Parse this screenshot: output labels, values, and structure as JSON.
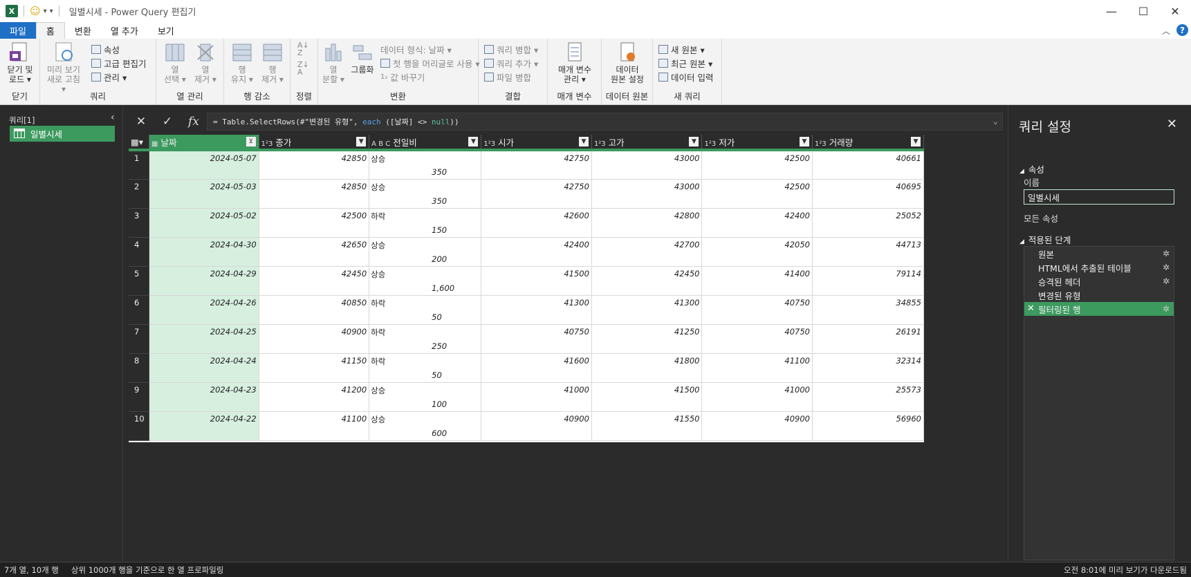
{
  "titlebar": {
    "app_badge": "X",
    "title": "일별시세 - Power Query 편집기",
    "min": "—",
    "max": "☐",
    "close": "✕"
  },
  "menu": {
    "tabs": [
      "파일",
      "홈",
      "변환",
      "열 추가",
      "보기"
    ],
    "help": "?"
  },
  "ribbon": {
    "close_load": {
      "label1": "닫기 및",
      "label2": "로드 ▾",
      "group": "닫기"
    },
    "query": {
      "preview1": "미리 보기",
      "preview2": "새로 고침 ▾",
      "properties": "속성",
      "advanced_editor": "고급 편집기",
      "manage": "관리 ▾",
      "group": "쿼리"
    },
    "columns": {
      "choose1": "열",
      "choose2": "선택 ▾",
      "remove1": "열",
      "remove2": "제거 ▾",
      "group": "열 관리"
    },
    "rows": {
      "keep1": "행",
      "keep2": "유지 ▾",
      "remove1": "행",
      "remove2": "제거 ▾",
      "group": "행 감소"
    },
    "sort": {
      "group": "정렬"
    },
    "transform": {
      "split1": "열",
      "split2": "분할 ▾",
      "groupby": "그룹화",
      "datatype": "데이터 형식: 날짜 ▾",
      "first_row": "첫 행을 머리글로 사용 ▾",
      "replace": "값 바꾸기",
      "group": "변환"
    },
    "combine": {
      "merge": "쿼리 병합 ▾",
      "append": "쿼리 추가 ▾",
      "combine_files": "파일 병합",
      "group": "결합"
    },
    "params": {
      "label1": "매개 변수",
      "label2": "관리 ▾",
      "group": "매개 변수"
    },
    "datasource": {
      "label1": "데이터",
      "label2": "원본 설정",
      "group": "데이터 원본"
    },
    "newquery": {
      "new_source": "새 원본 ▾",
      "recent_source": "최근 원본 ▾",
      "enter_data": "데이터 입력",
      "group": "새 쿼리"
    }
  },
  "queries_pane": {
    "header": "쿼리[1]",
    "items": [
      "일별시세"
    ]
  },
  "formula": {
    "prefix": "= Table.SelectRows(#\"변경된 유형\", ",
    "kw": "each",
    "mid": " ([날짜] <> ",
    "null": "null",
    "suffix": "))"
  },
  "table": {
    "columns": [
      {
        "type": "▦",
        "name": "날짜"
      },
      {
        "type": "1²3",
        "name": "종가"
      },
      {
        "type": "A B C",
        "name": "전일비"
      },
      {
        "type": "1²3",
        "name": "시가"
      },
      {
        "type": "1²3",
        "name": "고가"
      },
      {
        "type": "1²3",
        "name": "저가"
      },
      {
        "type": "1²3",
        "name": "거래량"
      }
    ],
    "rows": [
      {
        "i": "1",
        "date": "2024-05-07",
        "close": "42850",
        "chg": "상승",
        "chgv": "350",
        "open": "42750",
        "high": "43000",
        "low": "42500",
        "vol": "40661"
      },
      {
        "i": "2",
        "date": "2024-05-03",
        "close": "42850",
        "chg": "상승",
        "chgv": "350",
        "open": "42750",
        "high": "43000",
        "low": "42500",
        "vol": "40695"
      },
      {
        "i": "3",
        "date": "2024-05-02",
        "close": "42500",
        "chg": "하락",
        "chgv": "150",
        "open": "42600",
        "high": "42800",
        "low": "42400",
        "vol": "25052"
      },
      {
        "i": "4",
        "date": "2024-04-30",
        "close": "42650",
        "chg": "상승",
        "chgv": "200",
        "open": "42400",
        "high": "42700",
        "low": "42050",
        "vol": "44713"
      },
      {
        "i": "5",
        "date": "2024-04-29",
        "close": "42450",
        "chg": "상승",
        "chgv": "1,600",
        "open": "41500",
        "high": "42450",
        "low": "41400",
        "vol": "79114"
      },
      {
        "i": "6",
        "date": "2024-04-26",
        "close": "40850",
        "chg": "하락",
        "chgv": "50",
        "open": "41300",
        "high": "41300",
        "low": "40750",
        "vol": "34855"
      },
      {
        "i": "7",
        "date": "2024-04-25",
        "close": "40900",
        "chg": "하락",
        "chgv": "250",
        "open": "40750",
        "high": "41250",
        "low": "40750",
        "vol": "26191"
      },
      {
        "i": "8",
        "date": "2024-04-24",
        "close": "41150",
        "chg": "하락",
        "chgv": "50",
        "open": "41600",
        "high": "41800",
        "low": "41100",
        "vol": "32314"
      },
      {
        "i": "9",
        "date": "2024-04-23",
        "close": "41200",
        "chg": "상승",
        "chgv": "100",
        "open": "41000",
        "high": "41500",
        "low": "41000",
        "vol": "25573"
      },
      {
        "i": "10",
        "date": "2024-04-22",
        "close": "41100",
        "chg": "상승",
        "chgv": "600",
        "open": "40900",
        "high": "41550",
        "low": "40900",
        "vol": "56960"
      }
    ]
  },
  "settings": {
    "title": "쿼리 설정",
    "properties": "속성",
    "name_label": "이름",
    "name_value": "일별시세",
    "all_props": "모든 속성",
    "applied_steps": "적용된 단계",
    "steps": [
      "원본",
      "HTML에서 추출된 테이블",
      "승격된 헤더",
      "변경된 유형",
      "필터링된 행"
    ]
  },
  "status": {
    "left": "7개 열, 10개 행",
    "profile": "상위 1000개 행을 기준으로 한 열 프로파일링",
    "right": "오전 8:01에 미리 보기가 다운로드됨"
  },
  "colors": {
    "accent": "#3c9a5f",
    "file_tab": "#1e6fc6"
  }
}
